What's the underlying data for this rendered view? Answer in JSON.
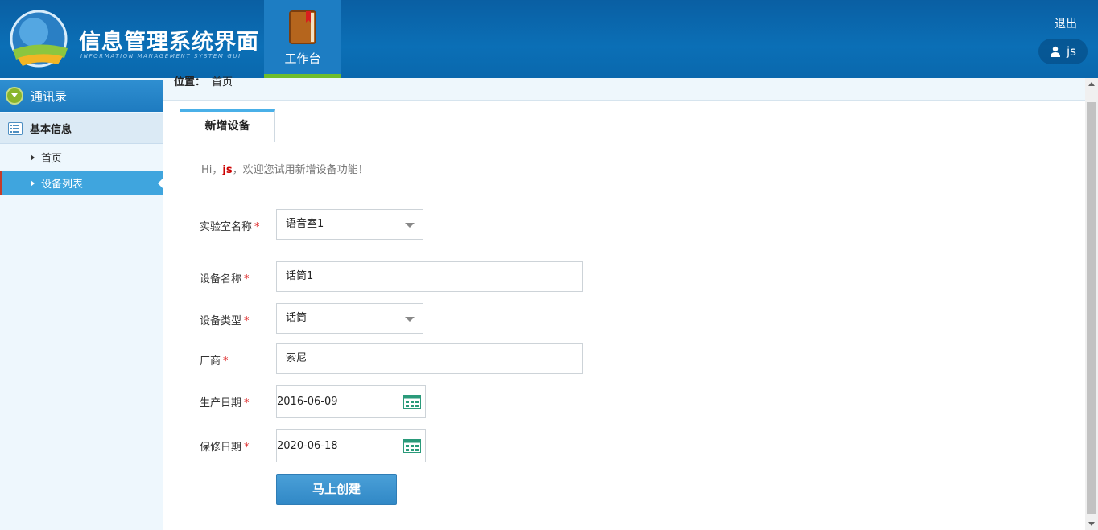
{
  "header": {
    "title": "信息管理系统界面",
    "subtitle": "INFORMATION MANAGEMENT SYSTEM GUI",
    "nav_tab_label": "工作台",
    "logout_label": "退出",
    "username": "js"
  },
  "sidebar": {
    "contacts_label": "通讯录",
    "basic_info_label": "基本信息",
    "items": [
      {
        "label": "首页",
        "active": false
      },
      {
        "label": "设备列表",
        "active": true
      }
    ]
  },
  "breadcrumb": {
    "prefix": "位置：",
    "current": "首页"
  },
  "tabs": [
    {
      "label": "新增设备",
      "active": true
    }
  ],
  "greeting": {
    "prefix": "Hi，",
    "user": "js",
    "suffix": "，欢迎您试用新增设备功能！"
  },
  "form": {
    "lab_name": {
      "label": "实验室名称",
      "value": "语音室1"
    },
    "device_name": {
      "label": "设备名称",
      "value": "话筒1"
    },
    "device_type": {
      "label": "设备类型",
      "value": "话筒"
    },
    "vendor": {
      "label": "厂商",
      "value": "索尼"
    },
    "production_date": {
      "label": "生产日期",
      "value": "2016-06-09"
    },
    "warranty_date": {
      "label": "保修日期",
      "value": "2020-06-18"
    },
    "required_mark": "*",
    "submit_label": "马上创建"
  },
  "colors": {
    "header_blue": "#0b6fb6",
    "accent_active": "#3fa5de",
    "required_red": "#dd2222",
    "button_blue": "#3188c6"
  },
  "icons": [
    "globe-logo-icon",
    "book-icon",
    "user-icon",
    "chevron-down-circle-icon",
    "list-icon",
    "calendar-icon"
  ]
}
